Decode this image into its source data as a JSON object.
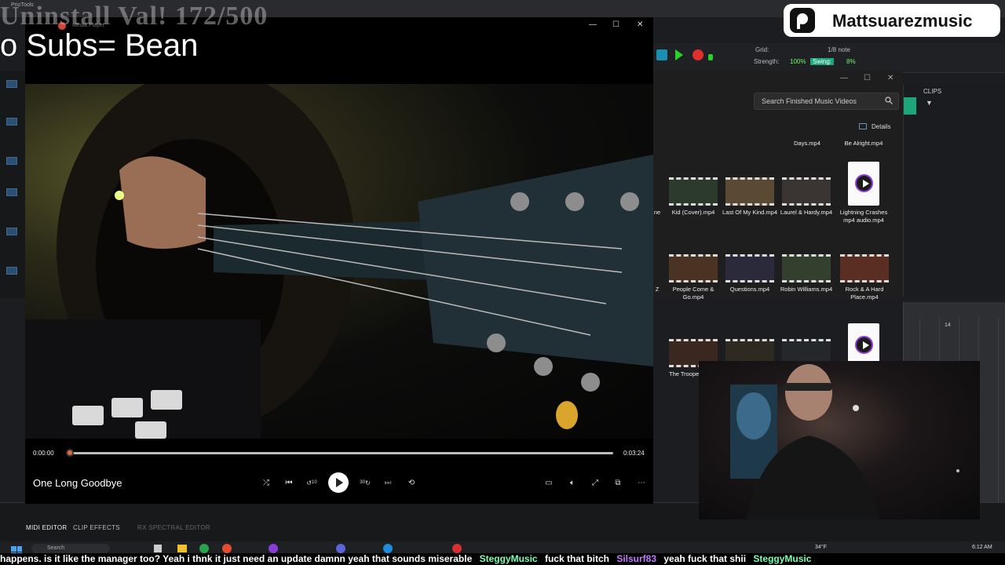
{
  "overlay": {
    "uninstall_goal": "Uninstall Val! 172/500",
    "subs_goal": "o Subs= Bean",
    "brand": "Mattsuarezmusic"
  },
  "daw": {
    "top_app": "PrioTools",
    "grid_label": "Grid:",
    "grid_value": "1/8 note",
    "strength_label": "Strength:",
    "strength_value": "100%",
    "swing_label": "Swing:",
    "swing_value": "8%",
    "clips_label": "CLIPS",
    "bottom_tabs": [
      "MIDI EDITOR",
      "CLIP EFFECTS",
      "RX SPECTRAL EDITOR"
    ],
    "ruler_marker": "14",
    "colors": {
      "accent_green": "#1fa57a",
      "record_red": "#e0302b",
      "play_green": "#2bd12b"
    }
  },
  "explorer": {
    "search_placeholder": "Search Finished Music Videos",
    "details_label": "Details",
    "top_row": [
      "Days.mp4",
      "Be Alright.mp4"
    ],
    "row1": [
      "Kid (Cover).mp4",
      "Last Of My Kind.mp4",
      "Laurel & Hardy.mp4",
      "Lightning Crashes mp4 audio.mp4"
    ],
    "row2": [
      "People Come & Go.mp4",
      "Questions.mp4",
      "Robin Williams.mp4",
      "Rock & A Hard Place.mp4"
    ],
    "row3": [
      "The Troope"
    ],
    "partial_labels": [
      "ne",
      "Z"
    ]
  },
  "player": {
    "window_title": "Media Player",
    "track_title": "One Long Goodbye",
    "time_current": "0:00:00",
    "time_total": "0:03:24",
    "progress_fraction": 0.0,
    "skip_back_label": "10",
    "skip_forward_label": "30",
    "icons": [
      "shuffle-icon",
      "previous-icon",
      "skip-back-10-icon",
      "play-icon",
      "skip-forward-30-icon",
      "next-icon",
      "repeat-off-icon",
      "subtitles-icon",
      "volume-icon",
      "fullscreen-icon",
      "miniplayer-icon",
      "more-icon"
    ]
  },
  "taskbar": {
    "search_placeholder": "Search",
    "weather": "34°F",
    "clock_time": "6:12 AM"
  },
  "chat_ticker": [
    {
      "type": "text",
      "value": "happens.  is it like the manager too?  Yeah i thnk it just need an update  damnn  yeah that sounds miserable"
    },
    {
      "type": "user",
      "value": "SteggyMusic"
    },
    {
      "type": "text",
      "value": "fuck that bitch"
    },
    {
      "type": "user2",
      "value": "Silsurf83"
    },
    {
      "type": "text",
      "value": "yeah fuck that shii"
    },
    {
      "type": "user",
      "value": "SteggyMusic"
    }
  ]
}
